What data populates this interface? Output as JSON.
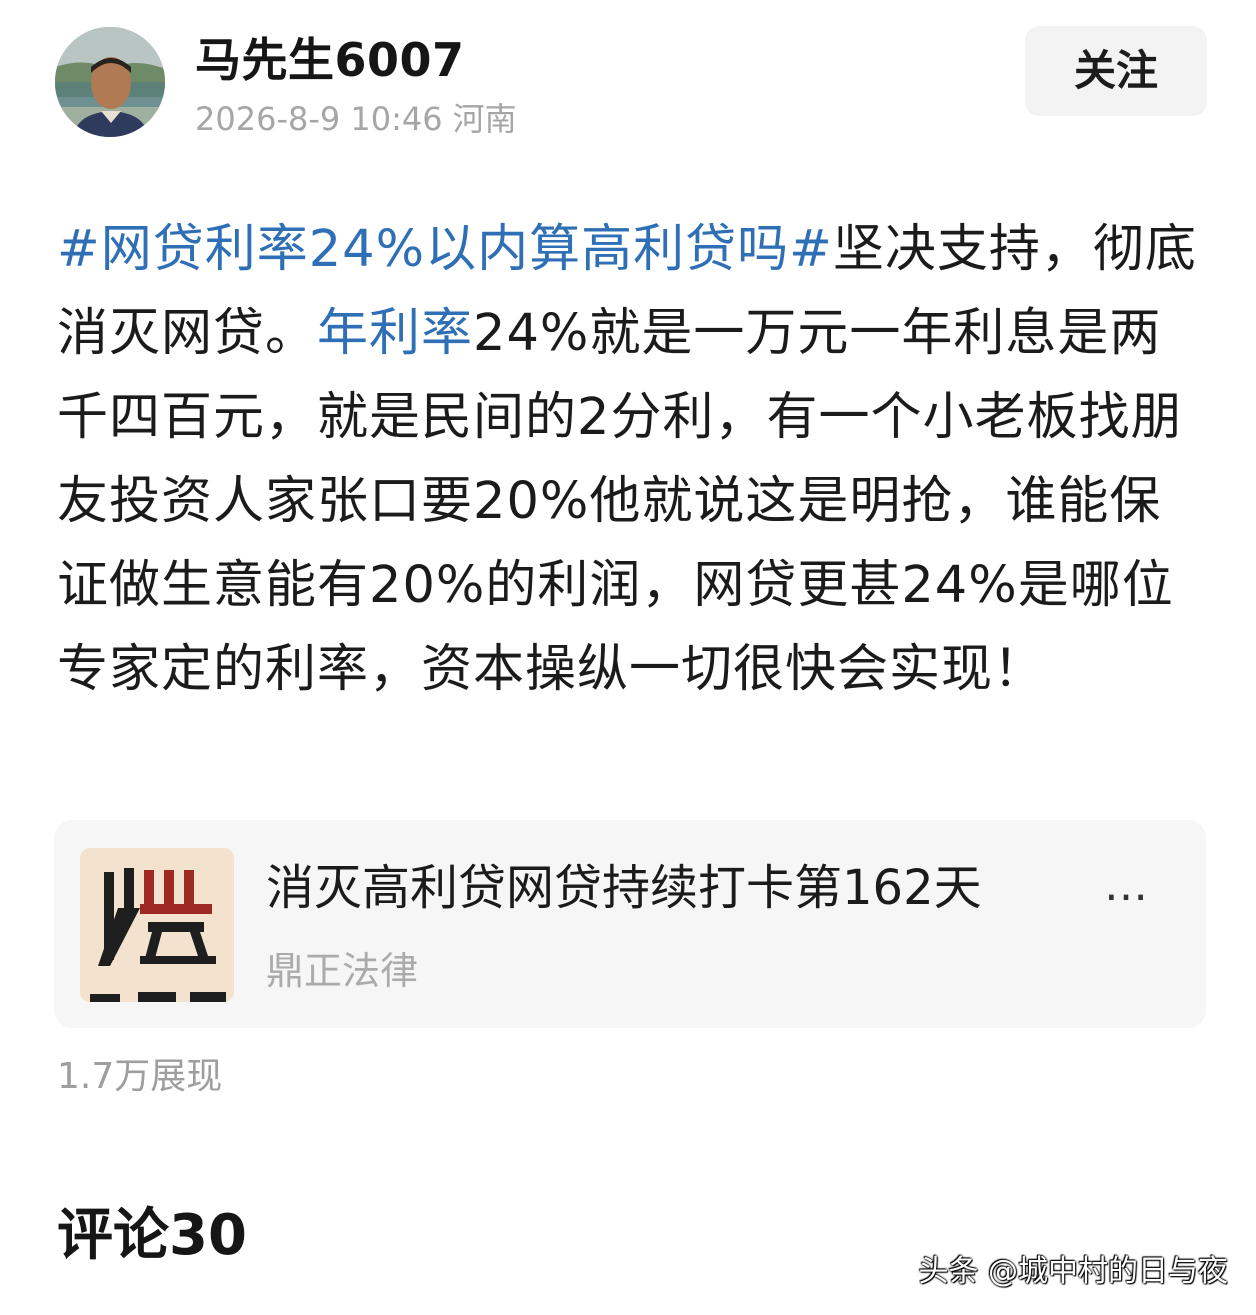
{
  "author": {
    "name": "马先生6007",
    "date": "2026-8-9 10:46",
    "location": "河南",
    "avatar_icon": "person-portrait"
  },
  "follow_label": "关注",
  "post": {
    "hashtag": "#网贷利率24%以内算高利贷吗#",
    "text_1": "坚决支持，彻底消灭网贷。",
    "link": "年利率",
    "text_2": "24%就是一万元一年利息是两千四百元，就是民间的2分利，有一个小老板找朋友投资人家张口要20%他就说这是明抢，谁能保证做生意能有20%的利润，网贷更甚24%是哪位专家定的利率，资本操纵一切很快会实现！"
  },
  "card": {
    "title": "消灭高利贷网贷持续打卡第162天",
    "ellipsis": "…",
    "source": "鼎正法律",
    "thumb_icon": "dingzheng-law-logo"
  },
  "views": "1.7万展现",
  "comments_heading": "评论30",
  "watermark": "头条 @城中村的日与夜",
  "colors": {
    "link": "#2f6fb6",
    "meta": "#a6a6a6",
    "card_bg": "#f6f6f6",
    "button_bg": "#f3f3f3"
  }
}
